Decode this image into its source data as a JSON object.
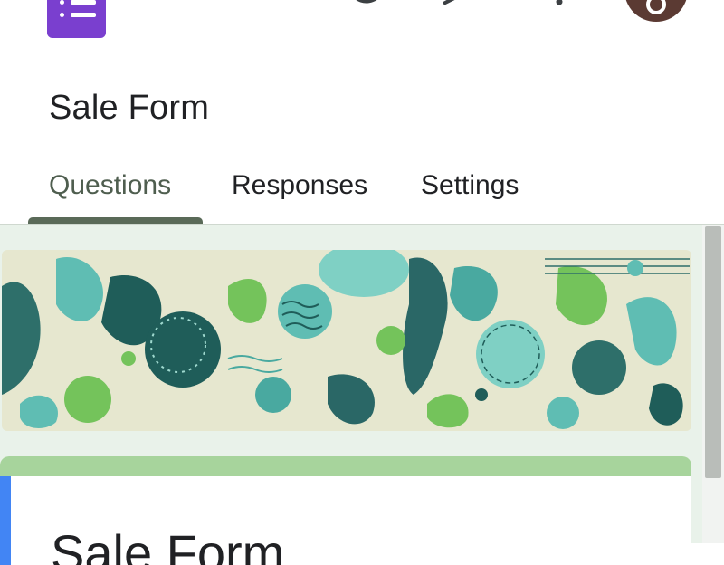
{
  "form": {
    "title": "Sale Form",
    "card_title": "Sale Form"
  },
  "tabs": [
    {
      "label": "Questions",
      "active": true
    },
    {
      "label": "Responses",
      "active": false
    },
    {
      "label": "Settings",
      "active": false
    }
  ],
  "icons": {
    "app": "google-forms-logo",
    "top_bar": [
      "palette-icon",
      "preview-icon",
      "send-icon",
      "more-vert-icon"
    ],
    "avatar": "account-avatar"
  },
  "colors": {
    "brand": "#7a3fcf",
    "tab_active": "#4f5e4f",
    "tab_indicator": "#5a6a58",
    "theme_background": "#e9f2ea",
    "header_accent": "#a7d49c",
    "focus_bar": "#4285f4",
    "avatar": "#5b3a33"
  }
}
